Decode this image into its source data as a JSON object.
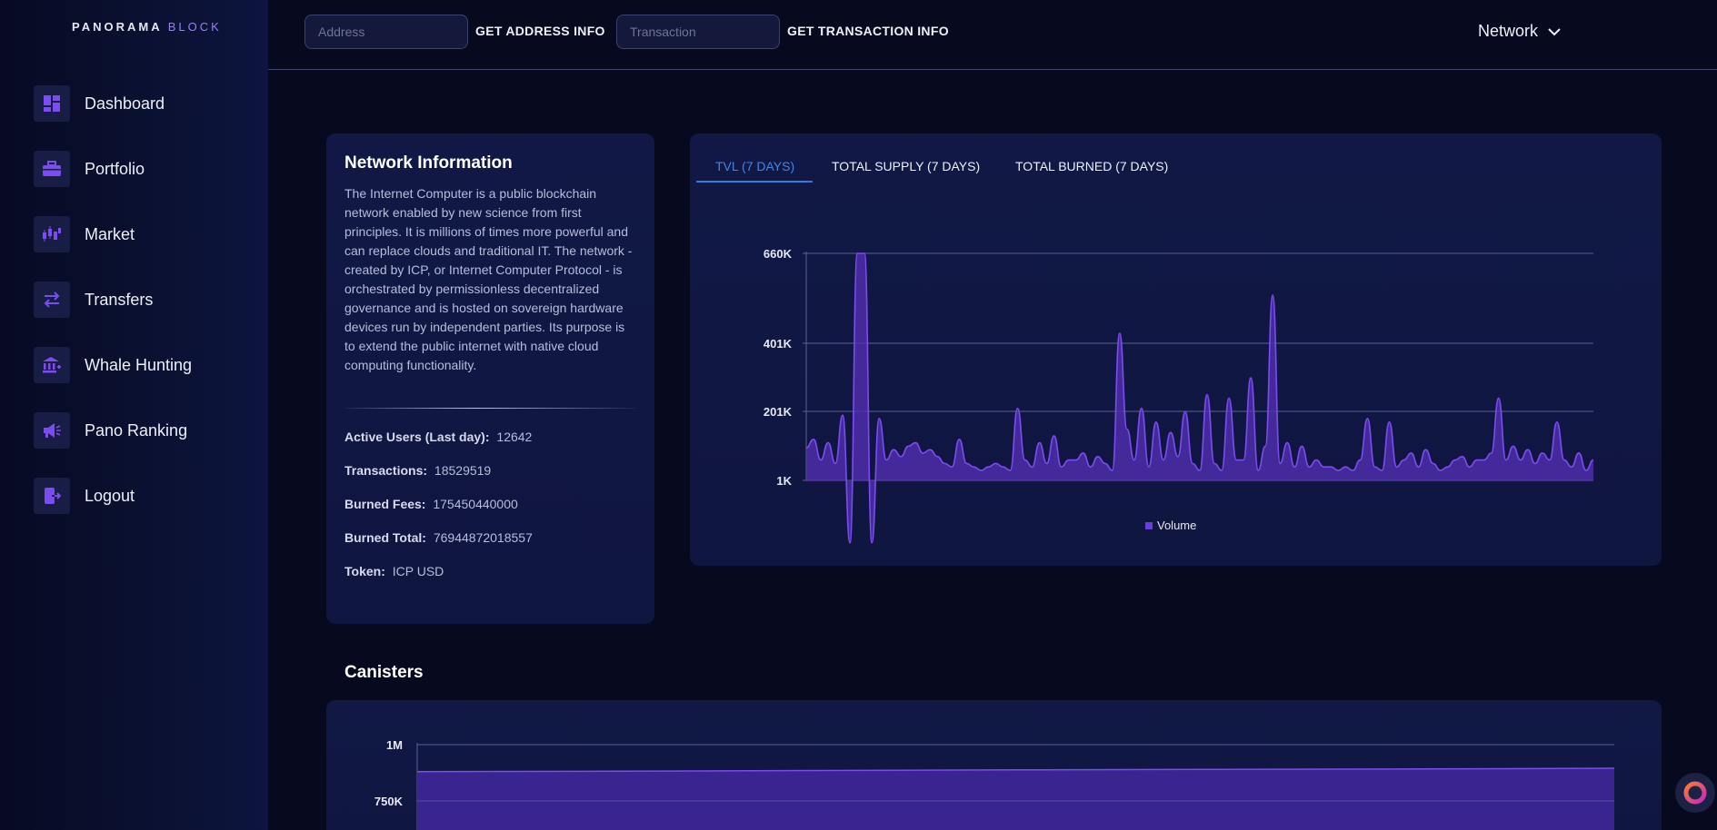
{
  "app": {
    "logo_main": "PANORAMA",
    "logo_accent": "BLOCK"
  },
  "sidebar": {
    "items": [
      {
        "label": "Dashboard",
        "icon": "dashboard-icon"
      },
      {
        "label": "Portfolio",
        "icon": "briefcase-icon"
      },
      {
        "label": "Market",
        "icon": "candlestick-icon"
      },
      {
        "label": "Transfers",
        "icon": "transfer-arrows-icon"
      },
      {
        "label": "Whale Hunting",
        "icon": "bank-icon"
      },
      {
        "label": "Pano Ranking",
        "icon": "megaphone-icon"
      },
      {
        "label": "Logout",
        "icon": "logout-icon"
      }
    ]
  },
  "header": {
    "address_placeholder": "Address",
    "address_button": "GET ADDRESS INFO",
    "transaction_placeholder": "Transaction",
    "transaction_button": "GET TRANSACTION INFO",
    "network_label": "Network"
  },
  "network_info": {
    "title": "Network Information",
    "description": "The Internet Computer is a public blockchain network enabled by new science from first principles. It is millions of times more powerful and can replace clouds and traditional IT. The network - created by ICP, or Internet Computer Protocol - is orchestrated by permissionless decentralized governance and is hosted on sovereign hardware devices run by independent parties. Its purpose is to extend the public internet with native cloud computing functionality.",
    "stats": [
      {
        "label": "Active Users (Last day):",
        "value": "12642"
      },
      {
        "label": "Transactions:",
        "value": "18529519"
      },
      {
        "label": "Burned Fees:",
        "value": "175450440000"
      },
      {
        "label": "Burned Total:",
        "value": "76944872018557"
      },
      {
        "label": "Token:",
        "value": "ICP USD"
      }
    ]
  },
  "chart_tabs": [
    {
      "label": "TVL (7 DAYS)",
      "active": true
    },
    {
      "label": "TOTAL SUPPLY (7 DAYS)",
      "active": false
    },
    {
      "label": "TOTAL BURNED (7 DAYS)",
      "active": false
    }
  ],
  "colors": {
    "accent": "#7b4cf0",
    "series": "#6a3fe0",
    "tab_active": "#3f86e8"
  },
  "chart_data": [
    {
      "type": "area",
      "ylim": [
        1000,
        660000
      ],
      "yticks": [
        1000,
        201000,
        401000,
        660000
      ],
      "ytick_labels": [
        "1K",
        "201K",
        "401K",
        "660K"
      ],
      "legend_position": "bottom-center",
      "series": [
        {
          "name": "Volume",
          "values": [
            95000,
            120000,
            60000,
            110000,
            50000,
            190000,
            -180000,
            660000,
            660000,
            -180000,
            180000,
            60000,
            90000,
            70000,
            100000,
            110000,
            80000,
            90000,
            70000,
            50000,
            40000,
            120000,
            50000,
            40000,
            30000,
            40000,
            50000,
            40000,
            30000,
            210000,
            60000,
            40000,
            110000,
            50000,
            130000,
            40000,
            60000,
            60000,
            80000,
            40000,
            70000,
            50000,
            30000,
            430000,
            150000,
            60000,
            210000,
            40000,
            170000,
            60000,
            140000,
            70000,
            200000,
            50000,
            30000,
            250000,
            50000,
            30000,
            240000,
            60000,
            60000,
            300000,
            30000,
            100000,
            540000,
            50000,
            110000,
            40000,
            100000,
            40000,
            60000,
            40000,
            40000,
            30000,
            40000,
            30000,
            60000,
            180000,
            40000,
            30000,
            170000,
            40000,
            60000,
            80000,
            40000,
            90000,
            50000,
            30000,
            40000,
            60000,
            70000,
            40000,
            60000,
            60000,
            80000,
            240000,
            60000,
            100000,
            60000,
            90000,
            50000,
            80000,
            60000,
            170000,
            60000,
            40000,
            80000,
            30000,
            60000
          ]
        }
      ]
    },
    {
      "type": "area",
      "title": "Canisters",
      "ytick_labels": [
        "1M",
        "750K"
      ],
      "series": [
        {
          "name": "",
          "values": [
            880000,
            882000,
            885000,
            888000,
            890000,
            892000,
            895000
          ]
        }
      ]
    }
  ],
  "canisters": {
    "title": "Canisters"
  }
}
